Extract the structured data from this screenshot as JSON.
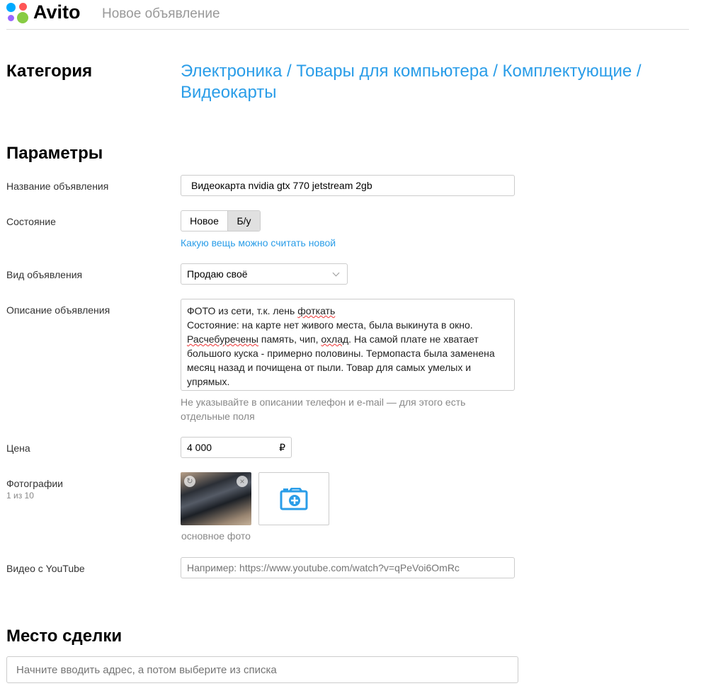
{
  "header": {
    "logo": "Avito",
    "title": "Новое объявление"
  },
  "category": {
    "heading": "Категория",
    "path_line1": "Электроника / Товары для компьютера / Комплектующие /",
    "path_line2": "Видеокарты"
  },
  "params": {
    "heading": "Параметры",
    "title_label": "Название объявления",
    "title_value": "Видеокарта nvidia gtx 770 jetstream 2gb",
    "condition_label": "Состояние",
    "condition_options": [
      "Новое",
      "Б/у"
    ],
    "condition_selected": "Б/у",
    "condition_help": "Какую вещь можно считать новой",
    "type_label": "Вид объявления",
    "type_value": "Продаю своё",
    "desc_label": "Описание объявления",
    "desc_lines": [
      "ФОТО из сети, т.к. лень ",
      "фоткать",
      "Состояние: на карте нет живого места, была выкинута в окно.",
      "Расчебуречены",
      " память, чип, ",
      "охлад",
      ". На самой плате не хватает",
      "большого куска - примерно половины. Термопаста была заменена",
      "месяц назад и почищена от пыли. Товар для самых умелых и",
      "упрямых."
    ],
    "desc_hint_line1": "Не указывайте в описании телефон и e-mail — для этого есть",
    "desc_hint_line2": "отдельные поля",
    "price_label": "Цена",
    "price_value": "4 000",
    "currency": "₽",
    "photos_label": "Фотографии",
    "photos_count": "1 из 10",
    "main_photo_caption": "основное фото",
    "video_label": "Видео с YouTube",
    "video_placeholder": "Например: https://www.youtube.com/watch?v=qPeVoi6OmRc"
  },
  "location": {
    "heading": "Место сделки",
    "placeholder": "Начните вводить адрес, а потом выберите из списка"
  },
  "colors": {
    "accent": "#2a9de8",
    "border": "#cccccc"
  }
}
